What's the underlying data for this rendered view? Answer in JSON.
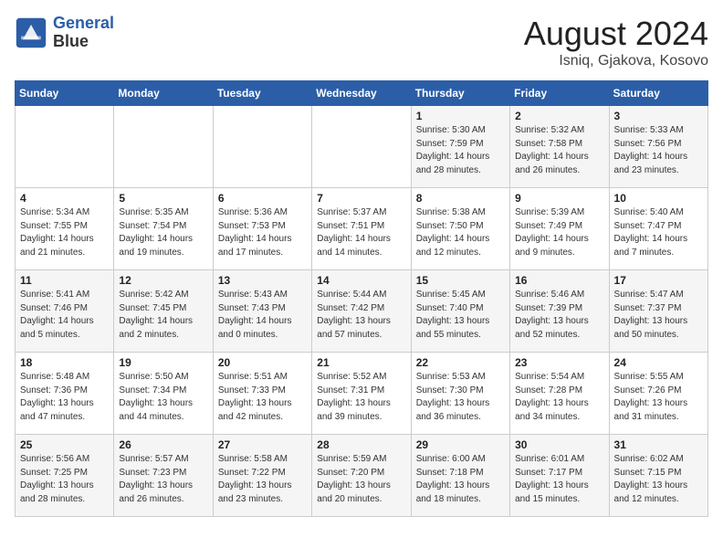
{
  "header": {
    "logo_line1": "General",
    "logo_line2": "Blue",
    "month_year": "August 2024",
    "location": "Isniq, Gjakova, Kosovo"
  },
  "weekdays": [
    "Sunday",
    "Monday",
    "Tuesday",
    "Wednesday",
    "Thursday",
    "Friday",
    "Saturday"
  ],
  "weeks": [
    [
      {
        "day": "",
        "info": ""
      },
      {
        "day": "",
        "info": ""
      },
      {
        "day": "",
        "info": ""
      },
      {
        "day": "",
        "info": ""
      },
      {
        "day": "1",
        "info": "Sunrise: 5:30 AM\nSunset: 7:59 PM\nDaylight: 14 hours\nand 28 minutes."
      },
      {
        "day": "2",
        "info": "Sunrise: 5:32 AM\nSunset: 7:58 PM\nDaylight: 14 hours\nand 26 minutes."
      },
      {
        "day": "3",
        "info": "Sunrise: 5:33 AM\nSunset: 7:56 PM\nDaylight: 14 hours\nand 23 minutes."
      }
    ],
    [
      {
        "day": "4",
        "info": "Sunrise: 5:34 AM\nSunset: 7:55 PM\nDaylight: 14 hours\nand 21 minutes."
      },
      {
        "day": "5",
        "info": "Sunrise: 5:35 AM\nSunset: 7:54 PM\nDaylight: 14 hours\nand 19 minutes."
      },
      {
        "day": "6",
        "info": "Sunrise: 5:36 AM\nSunset: 7:53 PM\nDaylight: 14 hours\nand 17 minutes."
      },
      {
        "day": "7",
        "info": "Sunrise: 5:37 AM\nSunset: 7:51 PM\nDaylight: 14 hours\nand 14 minutes."
      },
      {
        "day": "8",
        "info": "Sunrise: 5:38 AM\nSunset: 7:50 PM\nDaylight: 14 hours\nand 12 minutes."
      },
      {
        "day": "9",
        "info": "Sunrise: 5:39 AM\nSunset: 7:49 PM\nDaylight: 14 hours\nand 9 minutes."
      },
      {
        "day": "10",
        "info": "Sunrise: 5:40 AM\nSunset: 7:47 PM\nDaylight: 14 hours\nand 7 minutes."
      }
    ],
    [
      {
        "day": "11",
        "info": "Sunrise: 5:41 AM\nSunset: 7:46 PM\nDaylight: 14 hours\nand 5 minutes."
      },
      {
        "day": "12",
        "info": "Sunrise: 5:42 AM\nSunset: 7:45 PM\nDaylight: 14 hours\nand 2 minutes."
      },
      {
        "day": "13",
        "info": "Sunrise: 5:43 AM\nSunset: 7:43 PM\nDaylight: 14 hours\nand 0 minutes."
      },
      {
        "day": "14",
        "info": "Sunrise: 5:44 AM\nSunset: 7:42 PM\nDaylight: 13 hours\nand 57 minutes."
      },
      {
        "day": "15",
        "info": "Sunrise: 5:45 AM\nSunset: 7:40 PM\nDaylight: 13 hours\nand 55 minutes."
      },
      {
        "day": "16",
        "info": "Sunrise: 5:46 AM\nSunset: 7:39 PM\nDaylight: 13 hours\nand 52 minutes."
      },
      {
        "day": "17",
        "info": "Sunrise: 5:47 AM\nSunset: 7:37 PM\nDaylight: 13 hours\nand 50 minutes."
      }
    ],
    [
      {
        "day": "18",
        "info": "Sunrise: 5:48 AM\nSunset: 7:36 PM\nDaylight: 13 hours\nand 47 minutes."
      },
      {
        "day": "19",
        "info": "Sunrise: 5:50 AM\nSunset: 7:34 PM\nDaylight: 13 hours\nand 44 minutes."
      },
      {
        "day": "20",
        "info": "Sunrise: 5:51 AM\nSunset: 7:33 PM\nDaylight: 13 hours\nand 42 minutes."
      },
      {
        "day": "21",
        "info": "Sunrise: 5:52 AM\nSunset: 7:31 PM\nDaylight: 13 hours\nand 39 minutes."
      },
      {
        "day": "22",
        "info": "Sunrise: 5:53 AM\nSunset: 7:30 PM\nDaylight: 13 hours\nand 36 minutes."
      },
      {
        "day": "23",
        "info": "Sunrise: 5:54 AM\nSunset: 7:28 PM\nDaylight: 13 hours\nand 34 minutes."
      },
      {
        "day": "24",
        "info": "Sunrise: 5:55 AM\nSunset: 7:26 PM\nDaylight: 13 hours\nand 31 minutes."
      }
    ],
    [
      {
        "day": "25",
        "info": "Sunrise: 5:56 AM\nSunset: 7:25 PM\nDaylight: 13 hours\nand 28 minutes."
      },
      {
        "day": "26",
        "info": "Sunrise: 5:57 AM\nSunset: 7:23 PM\nDaylight: 13 hours\nand 26 minutes."
      },
      {
        "day": "27",
        "info": "Sunrise: 5:58 AM\nSunset: 7:22 PM\nDaylight: 13 hours\nand 23 minutes."
      },
      {
        "day": "28",
        "info": "Sunrise: 5:59 AM\nSunset: 7:20 PM\nDaylight: 13 hours\nand 20 minutes."
      },
      {
        "day": "29",
        "info": "Sunrise: 6:00 AM\nSunset: 7:18 PM\nDaylight: 13 hours\nand 18 minutes."
      },
      {
        "day": "30",
        "info": "Sunrise: 6:01 AM\nSunset: 7:17 PM\nDaylight: 13 hours\nand 15 minutes."
      },
      {
        "day": "31",
        "info": "Sunrise: 6:02 AM\nSunset: 7:15 PM\nDaylight: 13 hours\nand 12 minutes."
      }
    ]
  ]
}
